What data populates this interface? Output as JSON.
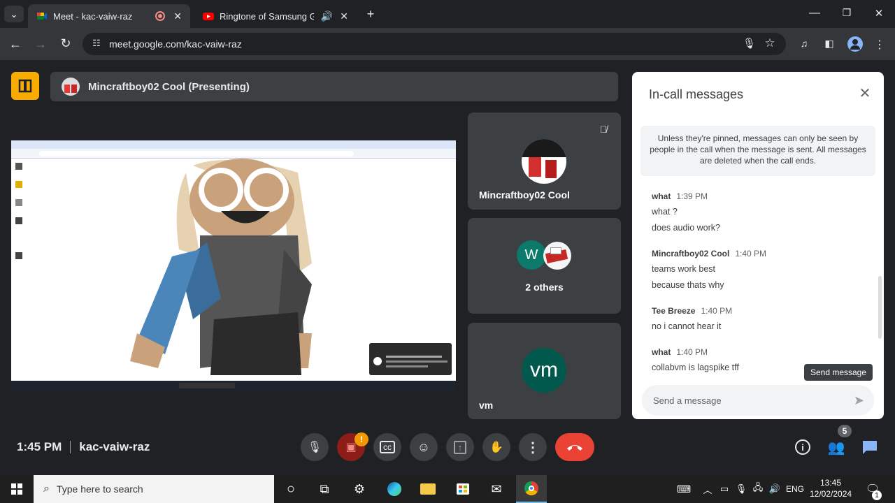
{
  "browser": {
    "tabs": [
      {
        "title": "Meet - kac-vaiw-raz",
        "active": true
      },
      {
        "title": "Ringtone of Samsung Galax",
        "active": false
      }
    ],
    "url": "meet.google.com/kac-vaiw-raz"
  },
  "meet": {
    "presenter_label": "Mincraftboy02 Cool (Presenting)",
    "tiles": [
      {
        "name": "Mincraftboy02 Cool"
      },
      {
        "name": "2 others",
        "avatar_letter": "W"
      },
      {
        "name": "vm",
        "avatar_text": "vm"
      }
    ],
    "time": "1:45 PM",
    "meeting_code": "kac-vaiw-raz",
    "people_count": "5",
    "camera_alert": "!",
    "colors": {
      "end_call": "#ea4335",
      "accent": "#1a73e8",
      "logo": "#f9ab00"
    }
  },
  "chat": {
    "title": "In-call messages",
    "notice": "Unless they're pinned, messages can only be seen by people in the call when the message is sent. All messages are deleted when the call ends.",
    "groups": [
      {
        "sender": "what",
        "time": "1:39 PM",
        "messages": [
          "what ?",
          "does audio work?"
        ]
      },
      {
        "sender": "Mincraftboy02 Cool",
        "time": "1:40 PM",
        "messages": [
          "teams work best",
          "because thats why"
        ]
      },
      {
        "sender": "Tee Breeze",
        "time": "1:40 PM",
        "messages": [
          "no i cannot hear it"
        ]
      },
      {
        "sender": "what",
        "time": "1:40 PM",
        "messages": [
          "collabvm is lagspike tff"
        ]
      }
    ],
    "input_placeholder": "Send a message",
    "send_tooltip": "Send message"
  },
  "taskbar": {
    "search_placeholder": "Type here to search",
    "lang": "ENG",
    "time": "13:45",
    "date": "12/02/2024",
    "notifications": "1"
  }
}
